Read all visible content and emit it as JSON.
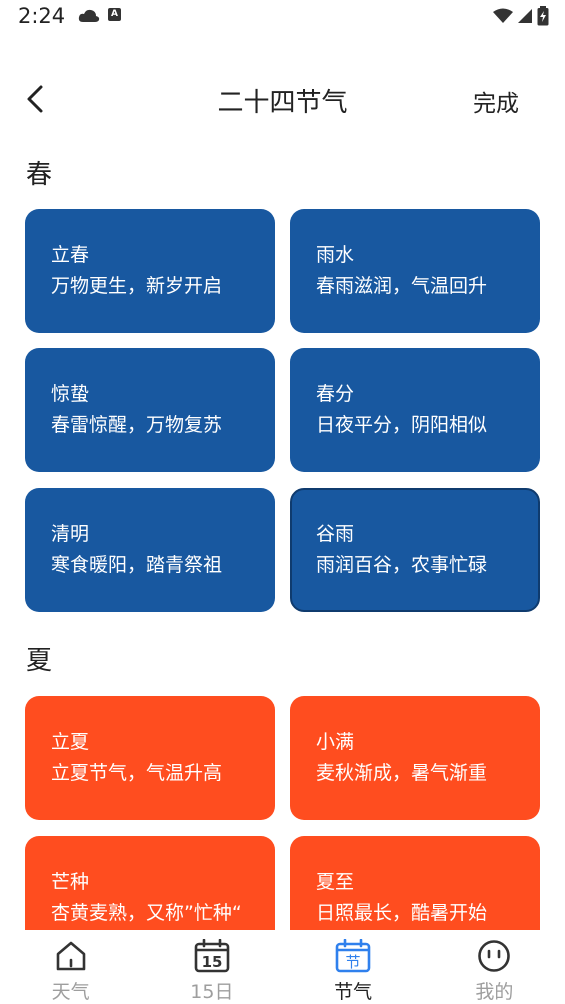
{
  "status_bar": {
    "time": "2:24",
    "notif_badge": "A"
  },
  "header": {
    "title": "二十四节气",
    "done_label": "完成"
  },
  "sections": [
    {
      "title": "春",
      "cards": [
        {
          "name": "立春",
          "desc": "万物更生，新岁开启"
        },
        {
          "name": "雨水",
          "desc": "春雨滋润，气温回升"
        },
        {
          "name": "惊蛰",
          "desc": "春雷惊醒，万物复苏"
        },
        {
          "name": "春分",
          "desc": "日夜平分，阴阳相似"
        },
        {
          "name": "清明",
          "desc": "寒食暖阳，踏青祭祖"
        },
        {
          "name": "谷雨",
          "desc": "雨润百谷，农事忙碌"
        }
      ]
    },
    {
      "title": "夏",
      "cards": [
        {
          "name": "立夏",
          "desc": "立夏节气，气温升高"
        },
        {
          "name": "小满",
          "desc": "麦秋渐成，暑气渐重"
        },
        {
          "name": "芒种",
          "desc": "杏黄麦熟，又称”忙种“"
        },
        {
          "name": "夏至",
          "desc": "日照最长，酷暑开始"
        }
      ]
    }
  ],
  "colors": {
    "spring": "#1858A0",
    "summer": "#FF4D1F",
    "nav_active": "#2F80ED",
    "nav_inactive": "#9e9e9e"
  },
  "bottom_nav": [
    {
      "label": "天气",
      "icon": "home-icon"
    },
    {
      "label": "15日",
      "icon": "calendar-15-icon",
      "icon_text": "15"
    },
    {
      "label": "节气",
      "icon": "solar-term-icon",
      "icon_text": "节",
      "active": true
    },
    {
      "label": "我的",
      "icon": "profile-face-icon"
    }
  ]
}
